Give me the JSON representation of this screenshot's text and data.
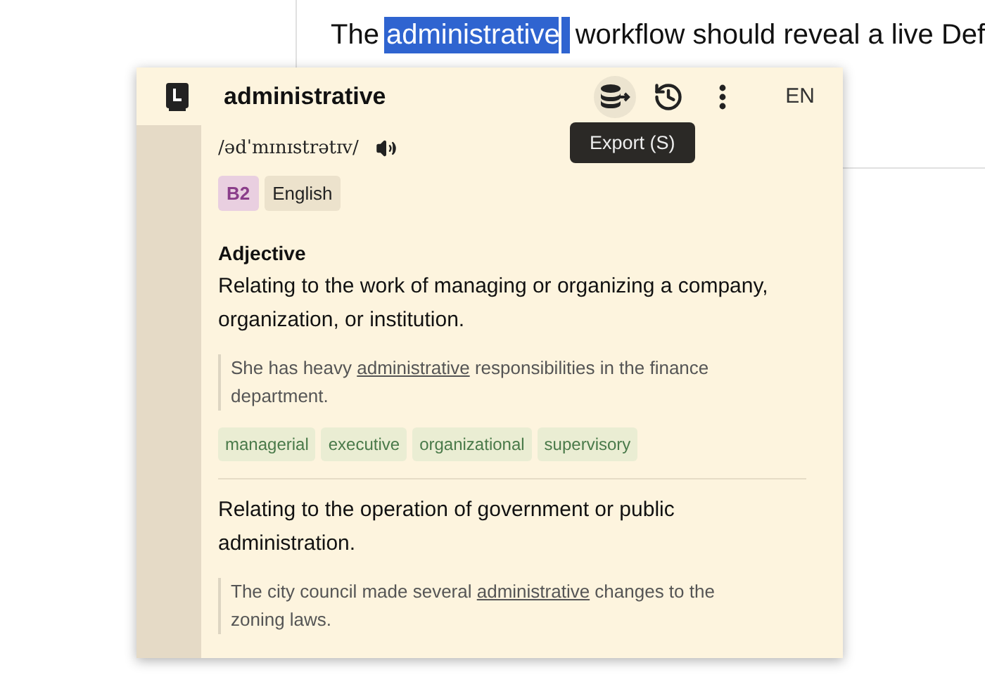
{
  "document": {
    "before": "The",
    "selected": "administrative",
    "after": "workflow should reveal a live Def"
  },
  "popup": {
    "word": "administrative",
    "toolbar": [
      {
        "kind": "export",
        "active": true
      },
      {
        "kind": "history",
        "active": false
      },
      {
        "kind": "more",
        "active": false
      }
    ],
    "language": "EN",
    "tooltip": "Export (S)",
    "pronunciation": "/ədˈmɪnɪstrətɪv/",
    "level": "B2",
    "source_language": "English",
    "senses": [
      {
        "part_of_speech": "Adjective",
        "definition": "Relating to the work of managing or organizing a company, organization, or institution.",
        "example": {
          "before": "She has heavy ",
          "highlight": "administrative",
          "after": " responsibilities in the finance department."
        },
        "synonyms": [
          "managerial",
          "executive",
          "organizational",
          "supervisory"
        ]
      },
      {
        "definition": "Relating to the operation of government or public administration.",
        "example": {
          "before": "The city council made several ",
          "highlight": "administrative",
          "after": " changes to the zoning laws."
        }
      }
    ]
  }
}
